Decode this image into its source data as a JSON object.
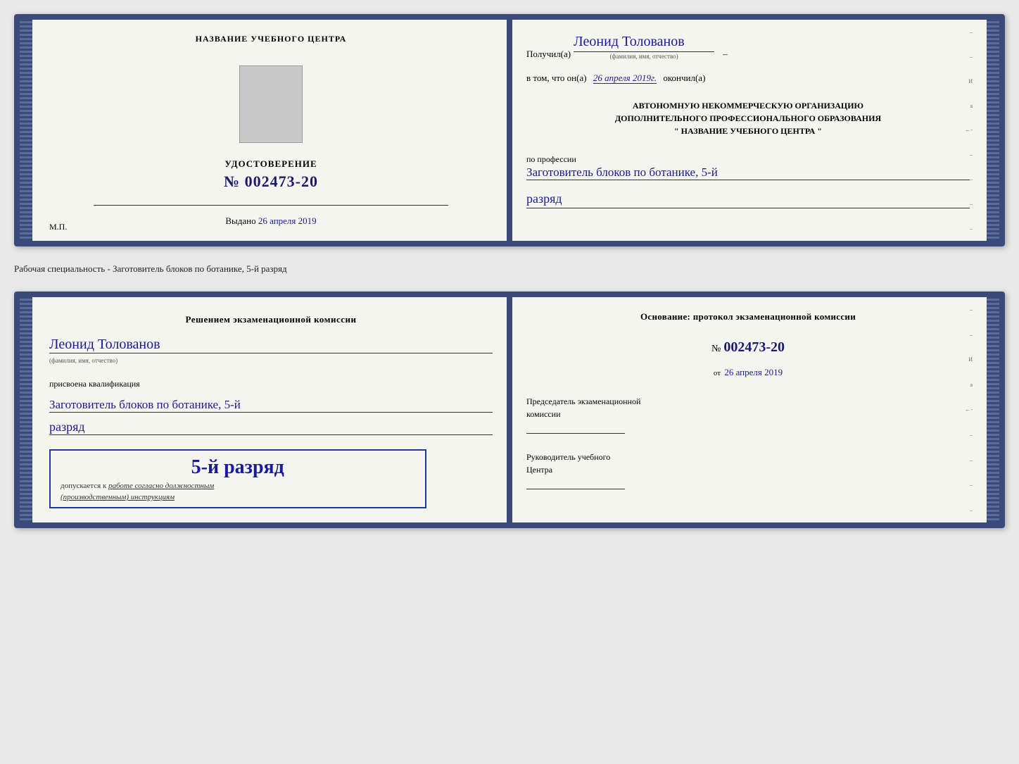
{
  "top_document": {
    "left": {
      "training_center_label": "НАЗВАНИЕ УЧЕБНОГО ЦЕНТРА",
      "cert_title": "УДОСТОВЕРЕНИЕ",
      "cert_number_prefix": "№",
      "cert_number": "002473-20",
      "issued_label": "Выдано",
      "issued_date": "26 апреля 2019",
      "mp_label": "М.П."
    },
    "right": {
      "received_prefix": "Получил(а)",
      "recipient_name": "Леонид Толованов",
      "fio_label": "(фамилия, имя, отчество)",
      "certified_text": "в том, что он(а)",
      "certified_date": "26 апреля 2019г.",
      "finished_label": "окончил(а)",
      "org_line1": "АВТОНОМНУЮ НЕКОММЕРЧЕСКУЮ ОРГАНИЗАЦИЮ",
      "org_line2": "ДОПОЛНИТЕЛЬНОГО ПРОФЕССИОНАЛЬНОГО ОБРАЗОВАНИЯ",
      "org_line3": "\"  НАЗВАНИЕ УЧЕБНОГО ЦЕНТРА  \"",
      "profession_label": "по профессии",
      "profession_value": "Заготовитель блоков по ботанике, 5-й",
      "rank_value": "разряд"
    }
  },
  "separator": {
    "text": "Рабочая специальность - Заготовитель блоков по ботанике, 5-й разряд"
  },
  "bottom_document": {
    "left": {
      "decision_text": "Решением экзаменационной комиссии",
      "person_name": "Леонид Толованов",
      "fio_label": "(фамилия, имя, отчество)",
      "qualification_assigned": "присвоена квалификация",
      "qualification_value": "Заготовитель блоков по ботанике, 5-й",
      "rank_value": "разряд",
      "rank_big": "5-й разряд",
      "allows_prefix": "допускается к",
      "allows_italic": "работе согласно должностным",
      "allows_italic2": "(производственным) инструкциям"
    },
    "right": {
      "basis_title": "Основание: протокол экзаменационной комиссии",
      "protocol_prefix": "№",
      "protocol_number": "002473-20",
      "from_label": "от",
      "from_date": "26 апреля 2019",
      "chairman_title": "Председатель экзаменационной",
      "chairman_title2": "комиссии",
      "head_title": "Руководитель учебного",
      "head_title2": "Центра"
    }
  },
  "side_notes": {
    "note1": "И",
    "note2": "а",
    "note3": "←-"
  }
}
